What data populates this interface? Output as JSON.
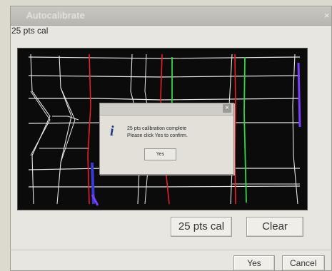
{
  "window": {
    "title": "Autocalibrate",
    "close_glyph": "×",
    "calibration_label": "25 pts cal"
  },
  "popup": {
    "close_glyph": "×",
    "info_glyph": "i",
    "message_line1": "25 pts calibration complete",
    "message_line2": "Please click Yes to confirm.",
    "yes_label": "Yes"
  },
  "buttons": {
    "cal_label": "25 pts cal",
    "clear_label": "Clear",
    "yes_label": "Yes",
    "cancel_label": "Cancel"
  },
  "colors": {
    "screen_bg": "#0b0b0b",
    "line_white": "#e6e6e6",
    "line_red": "#e8202a",
    "line_green": "#32d845",
    "line_blue": "#3a3ad8",
    "line_purple": "#7a3cff"
  }
}
